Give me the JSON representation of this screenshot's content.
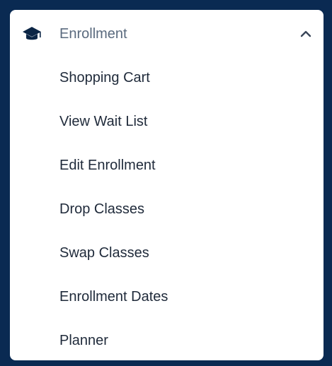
{
  "menu": {
    "header": {
      "label": "Enrollment",
      "icon": "graduation-cap-icon",
      "expanded_icon": "chevron-up-icon"
    },
    "items": [
      {
        "label": "Shopping Cart"
      },
      {
        "label": "View Wait List"
      },
      {
        "label": "Edit Enrollment"
      },
      {
        "label": "Drop Classes"
      },
      {
        "label": "Swap Classes"
      },
      {
        "label": "Enrollment Dates"
      },
      {
        "label": "Planner"
      }
    ]
  },
  "colors": {
    "frame": "#0a2a52",
    "icon": "#0b2545",
    "header_text": "#5a6a7e",
    "item_text": "#1f2a3a"
  }
}
